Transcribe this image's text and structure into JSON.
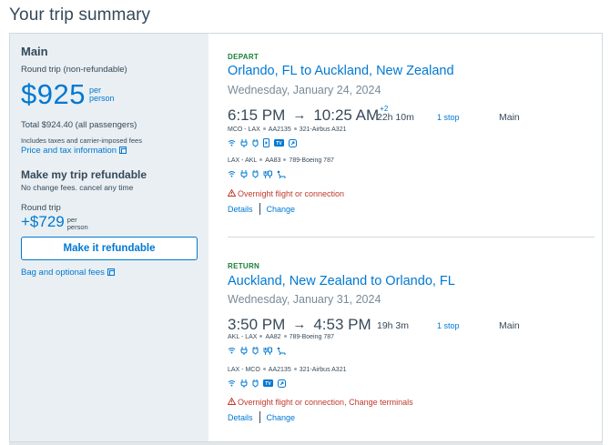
{
  "page": {
    "title": "Your trip summary"
  },
  "summary": {
    "label": "Main",
    "trip_type": "Round trip (non-refundable)",
    "price": "$925",
    "per": "per",
    "person": "person",
    "total": "Total $924.40 (all passengers)",
    "taxes_note": "Includes taxes and carrier-imposed fees",
    "price_tax_link": "Price and tax information",
    "refund_title": "Make my trip refundable",
    "refund_note": "No change fees. cancel any time",
    "refund_trip": "Round trip",
    "refund_price": "+$729",
    "refund_per": "per",
    "refund_person": "person",
    "refund_button": "Make it refundable",
    "bag_link": "Bag and optional fees"
  },
  "depart": {
    "label": "DEPART",
    "route": "Orlando, FL to Auckland, New Zealand",
    "date": "Wednesday, January 24, 2024",
    "dep_time": "6:15 PM",
    "arrow": "→",
    "arr_time": "10:25 AM",
    "day_offset": "+2",
    "duration": "22h 10m",
    "stops": "1 stop",
    "cabin": "Main",
    "legs": [
      {
        "route": "MCO - LAX",
        "flight": "AA2135",
        "aircraft": "321-Airbus A321"
      },
      {
        "route": "LAX - AKL",
        "flight": "AA83",
        "aircraft": "789-Boeing 787"
      }
    ],
    "warning": "Overnight flight or connection",
    "details": "Details",
    "change": "Change"
  },
  "return": {
    "label": "RETURN",
    "route": "Auckland, New Zealand to Orlando, FL",
    "date": "Wednesday, January 31, 2024",
    "dep_time": "3:50 PM",
    "arrow": "→",
    "arr_time": "4:53 PM",
    "duration": "19h 3m",
    "stops": "1 stop",
    "cabin": "Main",
    "legs": [
      {
        "route": "AKL - LAX",
        "flight": "AA82",
        "aircraft": "789-Boeing 787"
      },
      {
        "route": "LAX - MCO",
        "flight": "AA2135",
        "aircraft": "321-Airbus A321"
      }
    ],
    "warning": "Overnight flight or connection, Change terminals",
    "details": "Details",
    "change": "Change"
  },
  "icons": {
    "amenities": [
      "wifi-icon",
      "power-icon",
      "usb-icon",
      "streaming-icon",
      "tv-icon",
      "apps-icon",
      "lie-flat-seat-icon",
      "dining-icon",
      "warning-icon",
      "copy-icon"
    ],
    "amenity_color": "#0078d2",
    "warning_color": "#c0392b",
    "depart_label_color": "#1a7f37"
  }
}
